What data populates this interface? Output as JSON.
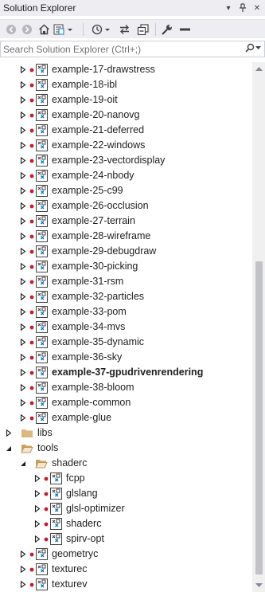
{
  "window": {
    "title": "Solution Explorer",
    "pin_glyph": "▾",
    "autohide_glyph": "‡",
    "close_glyph": "✕"
  },
  "toolbar": {
    "icons": [
      "back-icon",
      "forward-icon",
      "home-icon",
      "switch-views-icon",
      "pending-changes-icon",
      "sync-icon",
      "collapse-all-icon",
      "properties-icon",
      "preview-icon"
    ]
  },
  "search": {
    "placeholder": "Search Solution Explorer (Ctrl+;)",
    "value": ""
  },
  "scrollbar": {
    "thumb_start": 0.37,
    "thumb_end": 0.99
  },
  "colors": {
    "accent": "#007acc",
    "dot_red": "#c5192d",
    "folder": "#dcb67a",
    "chrome": "#eeeef2"
  },
  "tree": [
    {
      "label": "example-17-drawstress",
      "kind": "project",
      "level": 2,
      "expanded": false
    },
    {
      "label": "example-18-ibl",
      "kind": "project",
      "level": 2,
      "expanded": false
    },
    {
      "label": "example-19-oit",
      "kind": "project",
      "level": 2,
      "expanded": false
    },
    {
      "label": "example-20-nanovg",
      "kind": "project",
      "level": 2,
      "expanded": false
    },
    {
      "label": "example-21-deferred",
      "kind": "project",
      "level": 2,
      "expanded": false
    },
    {
      "label": "example-22-windows",
      "kind": "project",
      "level": 2,
      "expanded": false
    },
    {
      "label": "example-23-vectordisplay",
      "kind": "project",
      "level": 2,
      "expanded": false
    },
    {
      "label": "example-24-nbody",
      "kind": "project",
      "level": 2,
      "expanded": false
    },
    {
      "label": "example-25-c99",
      "kind": "project",
      "level": 2,
      "expanded": false
    },
    {
      "label": "example-26-occlusion",
      "kind": "project",
      "level": 2,
      "expanded": false
    },
    {
      "label": "example-27-terrain",
      "kind": "project",
      "level": 2,
      "expanded": false
    },
    {
      "label": "example-28-wireframe",
      "kind": "project",
      "level": 2,
      "expanded": false
    },
    {
      "label": "example-29-debugdraw",
      "kind": "project",
      "level": 2,
      "expanded": false
    },
    {
      "label": "example-30-picking",
      "kind": "project",
      "level": 2,
      "expanded": false
    },
    {
      "label": "example-31-rsm",
      "kind": "project",
      "level": 2,
      "expanded": false
    },
    {
      "label": "example-32-particles",
      "kind": "project",
      "level": 2,
      "expanded": false
    },
    {
      "label": "example-33-pom",
      "kind": "project",
      "level": 2,
      "expanded": false
    },
    {
      "label": "example-34-mvs",
      "kind": "project",
      "level": 2,
      "expanded": false
    },
    {
      "label": "example-35-dynamic",
      "kind": "project",
      "level": 2,
      "expanded": false
    },
    {
      "label": "example-36-sky",
      "kind": "project",
      "level": 2,
      "expanded": false
    },
    {
      "label": "example-37-gpudrivenrendering",
      "kind": "project",
      "level": 2,
      "expanded": false,
      "bold": true
    },
    {
      "label": "example-38-bloom",
      "kind": "project",
      "level": 2,
      "expanded": false
    },
    {
      "label": "example-common",
      "kind": "project",
      "level": 2,
      "expanded": false
    },
    {
      "label": "example-glue",
      "kind": "project",
      "level": 2,
      "expanded": false
    },
    {
      "label": "libs",
      "kind": "folder",
      "level": 1,
      "expanded": false
    },
    {
      "label": "tools",
      "kind": "folder",
      "level": 1,
      "expanded": true
    },
    {
      "label": "shaderc",
      "kind": "folder",
      "level": 2,
      "expanded": true
    },
    {
      "label": "fcpp",
      "kind": "project",
      "level": 3,
      "expanded": false
    },
    {
      "label": "glslang",
      "kind": "project",
      "level": 3,
      "expanded": false
    },
    {
      "label": "glsl-optimizer",
      "kind": "project",
      "level": 3,
      "expanded": false
    },
    {
      "label": "shaderc",
      "kind": "project",
      "level": 3,
      "expanded": false
    },
    {
      "label": "spirv-opt",
      "kind": "project",
      "level": 3,
      "expanded": false
    },
    {
      "label": "geometryc",
      "kind": "project",
      "level": 2,
      "expanded": false
    },
    {
      "label": "texturec",
      "kind": "project",
      "level": 2,
      "expanded": false
    },
    {
      "label": "texturev",
      "kind": "project",
      "level": 2,
      "expanded": false
    }
  ]
}
